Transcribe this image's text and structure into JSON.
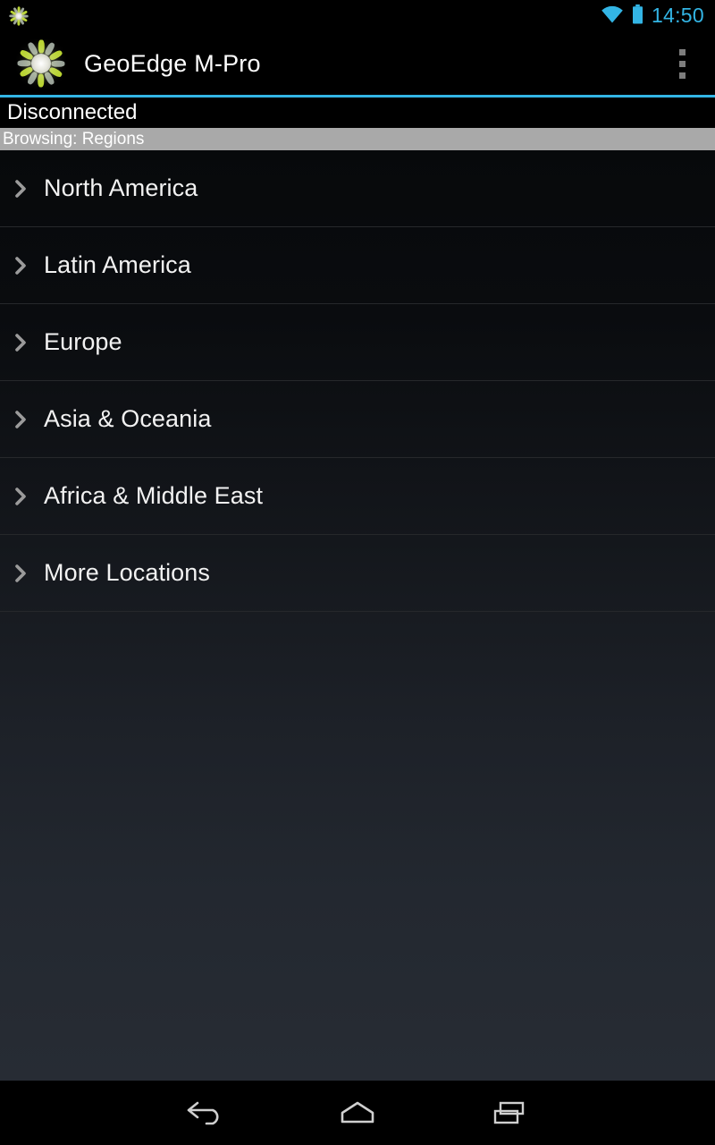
{
  "status_bar": {
    "notification_icon": "app-burst-icon",
    "wifi_icon": "wifi-icon",
    "battery_icon": "battery-icon",
    "clock": "14:50",
    "accent_color": "#33b5e5"
  },
  "action_bar": {
    "app_icon": "app-burst-icon",
    "title": "GeoEdge M-Pro",
    "overflow_icon": "overflow-menu-icon"
  },
  "connection": {
    "status_text": "Disconnected"
  },
  "browsing": {
    "label": "Browsing: Regions",
    "bar_color": "#a9a9a9"
  },
  "regions": [
    {
      "label": "North America",
      "icon": "chevron-right-icon"
    },
    {
      "label": "Latin America",
      "icon": "chevron-right-icon"
    },
    {
      "label": "Europe",
      "icon": "chevron-right-icon"
    },
    {
      "label": "Asia & Oceania",
      "icon": "chevron-right-icon"
    },
    {
      "label": "Africa & Middle East",
      "icon": "chevron-right-icon"
    },
    {
      "label": "More Locations",
      "icon": "chevron-right-icon"
    }
  ],
  "nav_bar": {
    "back_icon": "back-icon",
    "home_icon": "home-icon",
    "recents_icon": "recents-icon"
  }
}
